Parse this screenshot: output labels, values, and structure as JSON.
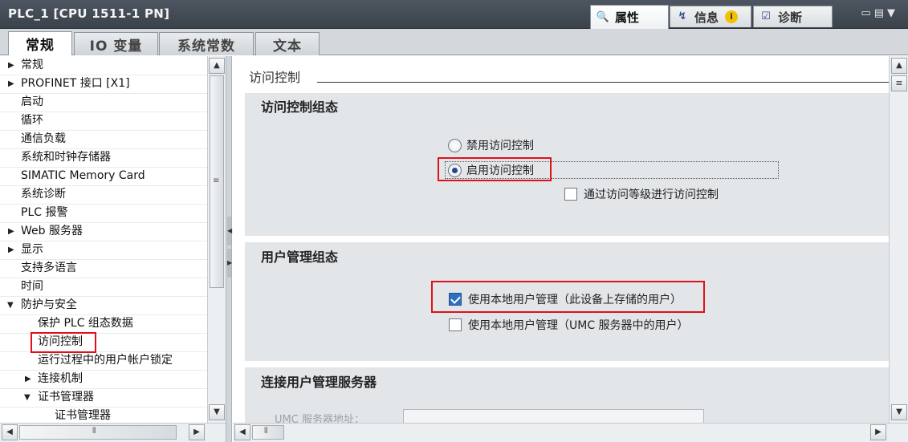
{
  "window": {
    "title": "PLC_1 [CPU 1511-1 PN]"
  },
  "inspector_tabs": [
    {
      "label": "属性",
      "icon": "properties-icon"
    },
    {
      "label": "信息",
      "icon": "info-icon",
      "badge": "i"
    },
    {
      "label": "诊断",
      "icon": "diagnostics-icon"
    }
  ],
  "tabs": [
    "常规",
    "IO 变量",
    "系统常数",
    "文本"
  ],
  "tree": [
    {
      "label": "常规",
      "expander": "collapsed"
    },
    {
      "label": "PROFINET 接口 [X1]",
      "expander": "collapsed"
    },
    {
      "label": "启动"
    },
    {
      "label": "循环"
    },
    {
      "label": "通信负载"
    },
    {
      "label": "系统和时钟存储器"
    },
    {
      "label": "SIMATIC Memory Card"
    },
    {
      "label": "系统诊断"
    },
    {
      "label": "PLC 报警"
    },
    {
      "label": "Web 服务器",
      "expander": "collapsed"
    },
    {
      "label": "显示",
      "expander": "collapsed"
    },
    {
      "label": "支持多语言"
    },
    {
      "label": "时间"
    },
    {
      "label": "防护与安全",
      "expander": "expanded"
    },
    {
      "label": "保护 PLC 组态数据"
    },
    {
      "label": "访问控制",
      "selected": true
    },
    {
      "label": "运行过程中的用户帐户锁定"
    },
    {
      "label": "连接机制",
      "expander": "collapsed"
    },
    {
      "label": "证书管理器",
      "expander": "expanded"
    },
    {
      "label": "证书管理器"
    }
  ],
  "content": {
    "header": "访问控制",
    "access_section": {
      "title": "访问控制组态",
      "options": [
        {
          "label": "禁用访问控制",
          "checked": false
        },
        {
          "label": "启用访问控制",
          "checked": true
        }
      ],
      "level_checkbox": {
        "label": "通过访问等级进行访问控制",
        "checked": false
      }
    },
    "user_section": {
      "title": "用户管理组态",
      "options": [
        {
          "label": "使用本地用户管理（此设备上存储的用户）",
          "checked": true
        },
        {
          "label": "使用本地用户管理（UMC 服务器中的用户）",
          "checked": false
        }
      ]
    },
    "server_section": {
      "title": "连接用户管理服务器",
      "address_label": "UMC 服务器地址：",
      "address_value": ""
    }
  },
  "colors": {
    "highlight": "#e0101a",
    "accent": "#2f6fc2",
    "titlebar": "#444c55"
  }
}
